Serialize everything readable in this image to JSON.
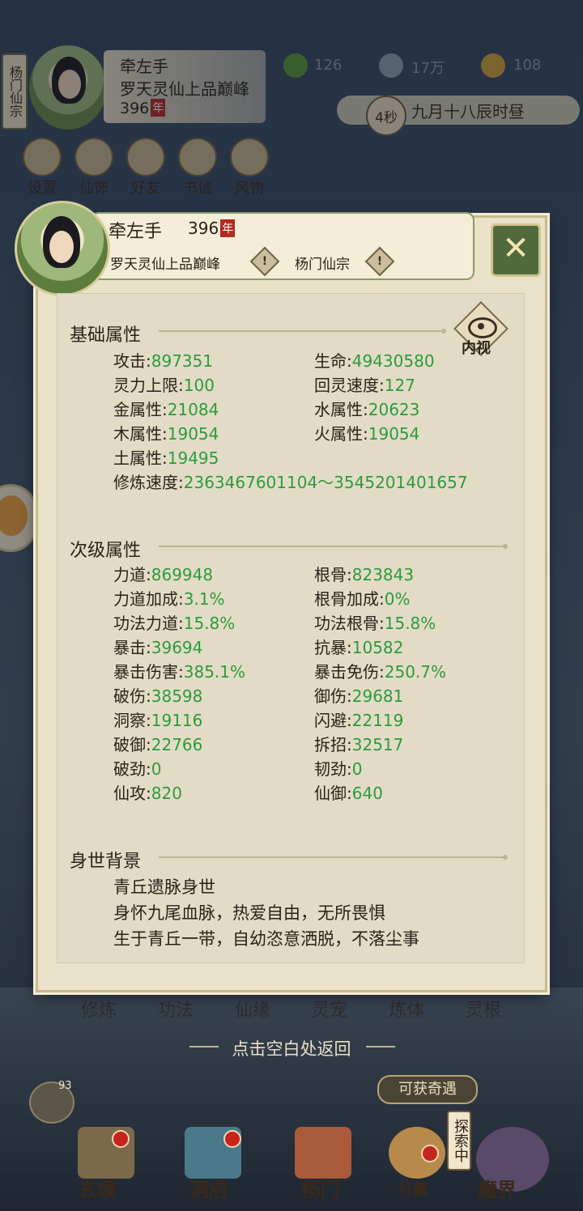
{
  "top": {
    "sect_vertical": "杨门仙宗",
    "name": "牵左手",
    "realm": "罗天灵仙上品巅峰",
    "age": "396",
    "age_unit": "年",
    "resources": [
      {
        "icon": "leaf-icon",
        "value": "126"
      },
      {
        "icon": "coin-icon",
        "value": "17万"
      },
      {
        "icon": "gold-ingot-icon",
        "value": "108"
      }
    ],
    "timer": "4秒",
    "game_time": "九月十八辰时昼",
    "menu": [
      "设置",
      "仙饰",
      "好友",
      "书信",
      "风物"
    ]
  },
  "panel": {
    "name": "牵左手",
    "age": "396",
    "age_unit": "年",
    "realm": "罗天灵仙上品巅峰",
    "sect": "杨门仙宗",
    "info_glyph": "!",
    "close_glyph": "✕",
    "inner_view_label": "内视",
    "basic_title": "基础属性",
    "basic": [
      {
        "label": "攻击:",
        "value": "897351"
      },
      {
        "label": "生命:",
        "value": "49430580"
      },
      {
        "label": "灵力上限:",
        "value": "100"
      },
      {
        "label": "回灵速度:",
        "value": "127"
      },
      {
        "label": "金属性:",
        "value": "21084"
      },
      {
        "label": "水属性:",
        "value": "20623"
      },
      {
        "label": "木属性:",
        "value": "19054"
      },
      {
        "label": "火属性:",
        "value": "19054"
      },
      {
        "label": "土属性:",
        "value": "19495"
      },
      {
        "label": "修炼速度:",
        "value": "2363467601104～3545201401657"
      }
    ],
    "secondary_title": "次级属性",
    "secondary": [
      {
        "label": "力道:",
        "value": "869948"
      },
      {
        "label": "根骨:",
        "value": "823843"
      },
      {
        "label": "力道加成:",
        "value": "3.1%"
      },
      {
        "label": "根骨加成:",
        "value": "0%"
      },
      {
        "label": "功法力道:",
        "value": "15.8%"
      },
      {
        "label": "功法根骨:",
        "value": "15.8%"
      },
      {
        "label": "暴击:",
        "value": "39694"
      },
      {
        "label": "抗暴:",
        "value": "10582"
      },
      {
        "label": "暴击伤害:",
        "value": "385.1%"
      },
      {
        "label": "暴击免伤:",
        "value": "250.7%"
      },
      {
        "label": "破伤:",
        "value": "38598"
      },
      {
        "label": "御伤:",
        "value": "29681"
      },
      {
        "label": "洞察:",
        "value": "19116"
      },
      {
        "label": "闪避:",
        "value": "22119"
      },
      {
        "label": "破御:",
        "value": "22766"
      },
      {
        "label": "拆招:",
        "value": "32517"
      },
      {
        "label": "破劲:",
        "value": "0"
      },
      {
        "label": "韧劲:",
        "value": "0"
      },
      {
        "label": "仙攻:",
        "value": "820"
      },
      {
        "label": "仙御:",
        "value": "640"
      }
    ],
    "bio_title": "身世背景",
    "bio": [
      "青丘遗脉身世",
      "身怀九尾血脉，热爱自由，无所畏惧",
      "生于青丘一带，自幼恣意洒脱，不落尘事"
    ]
  },
  "bottom": {
    "tabs": [
      "修炼",
      "功法",
      "仙缘",
      "灵宠",
      "炼体",
      "灵根"
    ],
    "hint": "点击空白处返回",
    "chat_count": "93",
    "qiyu": "可获奇遇",
    "tansuo": "探索中",
    "nav": [
      "玄境",
      "洞府",
      "杨门",
      "行囊",
      "魔界"
    ]
  },
  "colors": {
    "value_green": "#2e9a3c",
    "panel_bg": "#e9e2c8",
    "accent_red": "#b32a24"
  }
}
